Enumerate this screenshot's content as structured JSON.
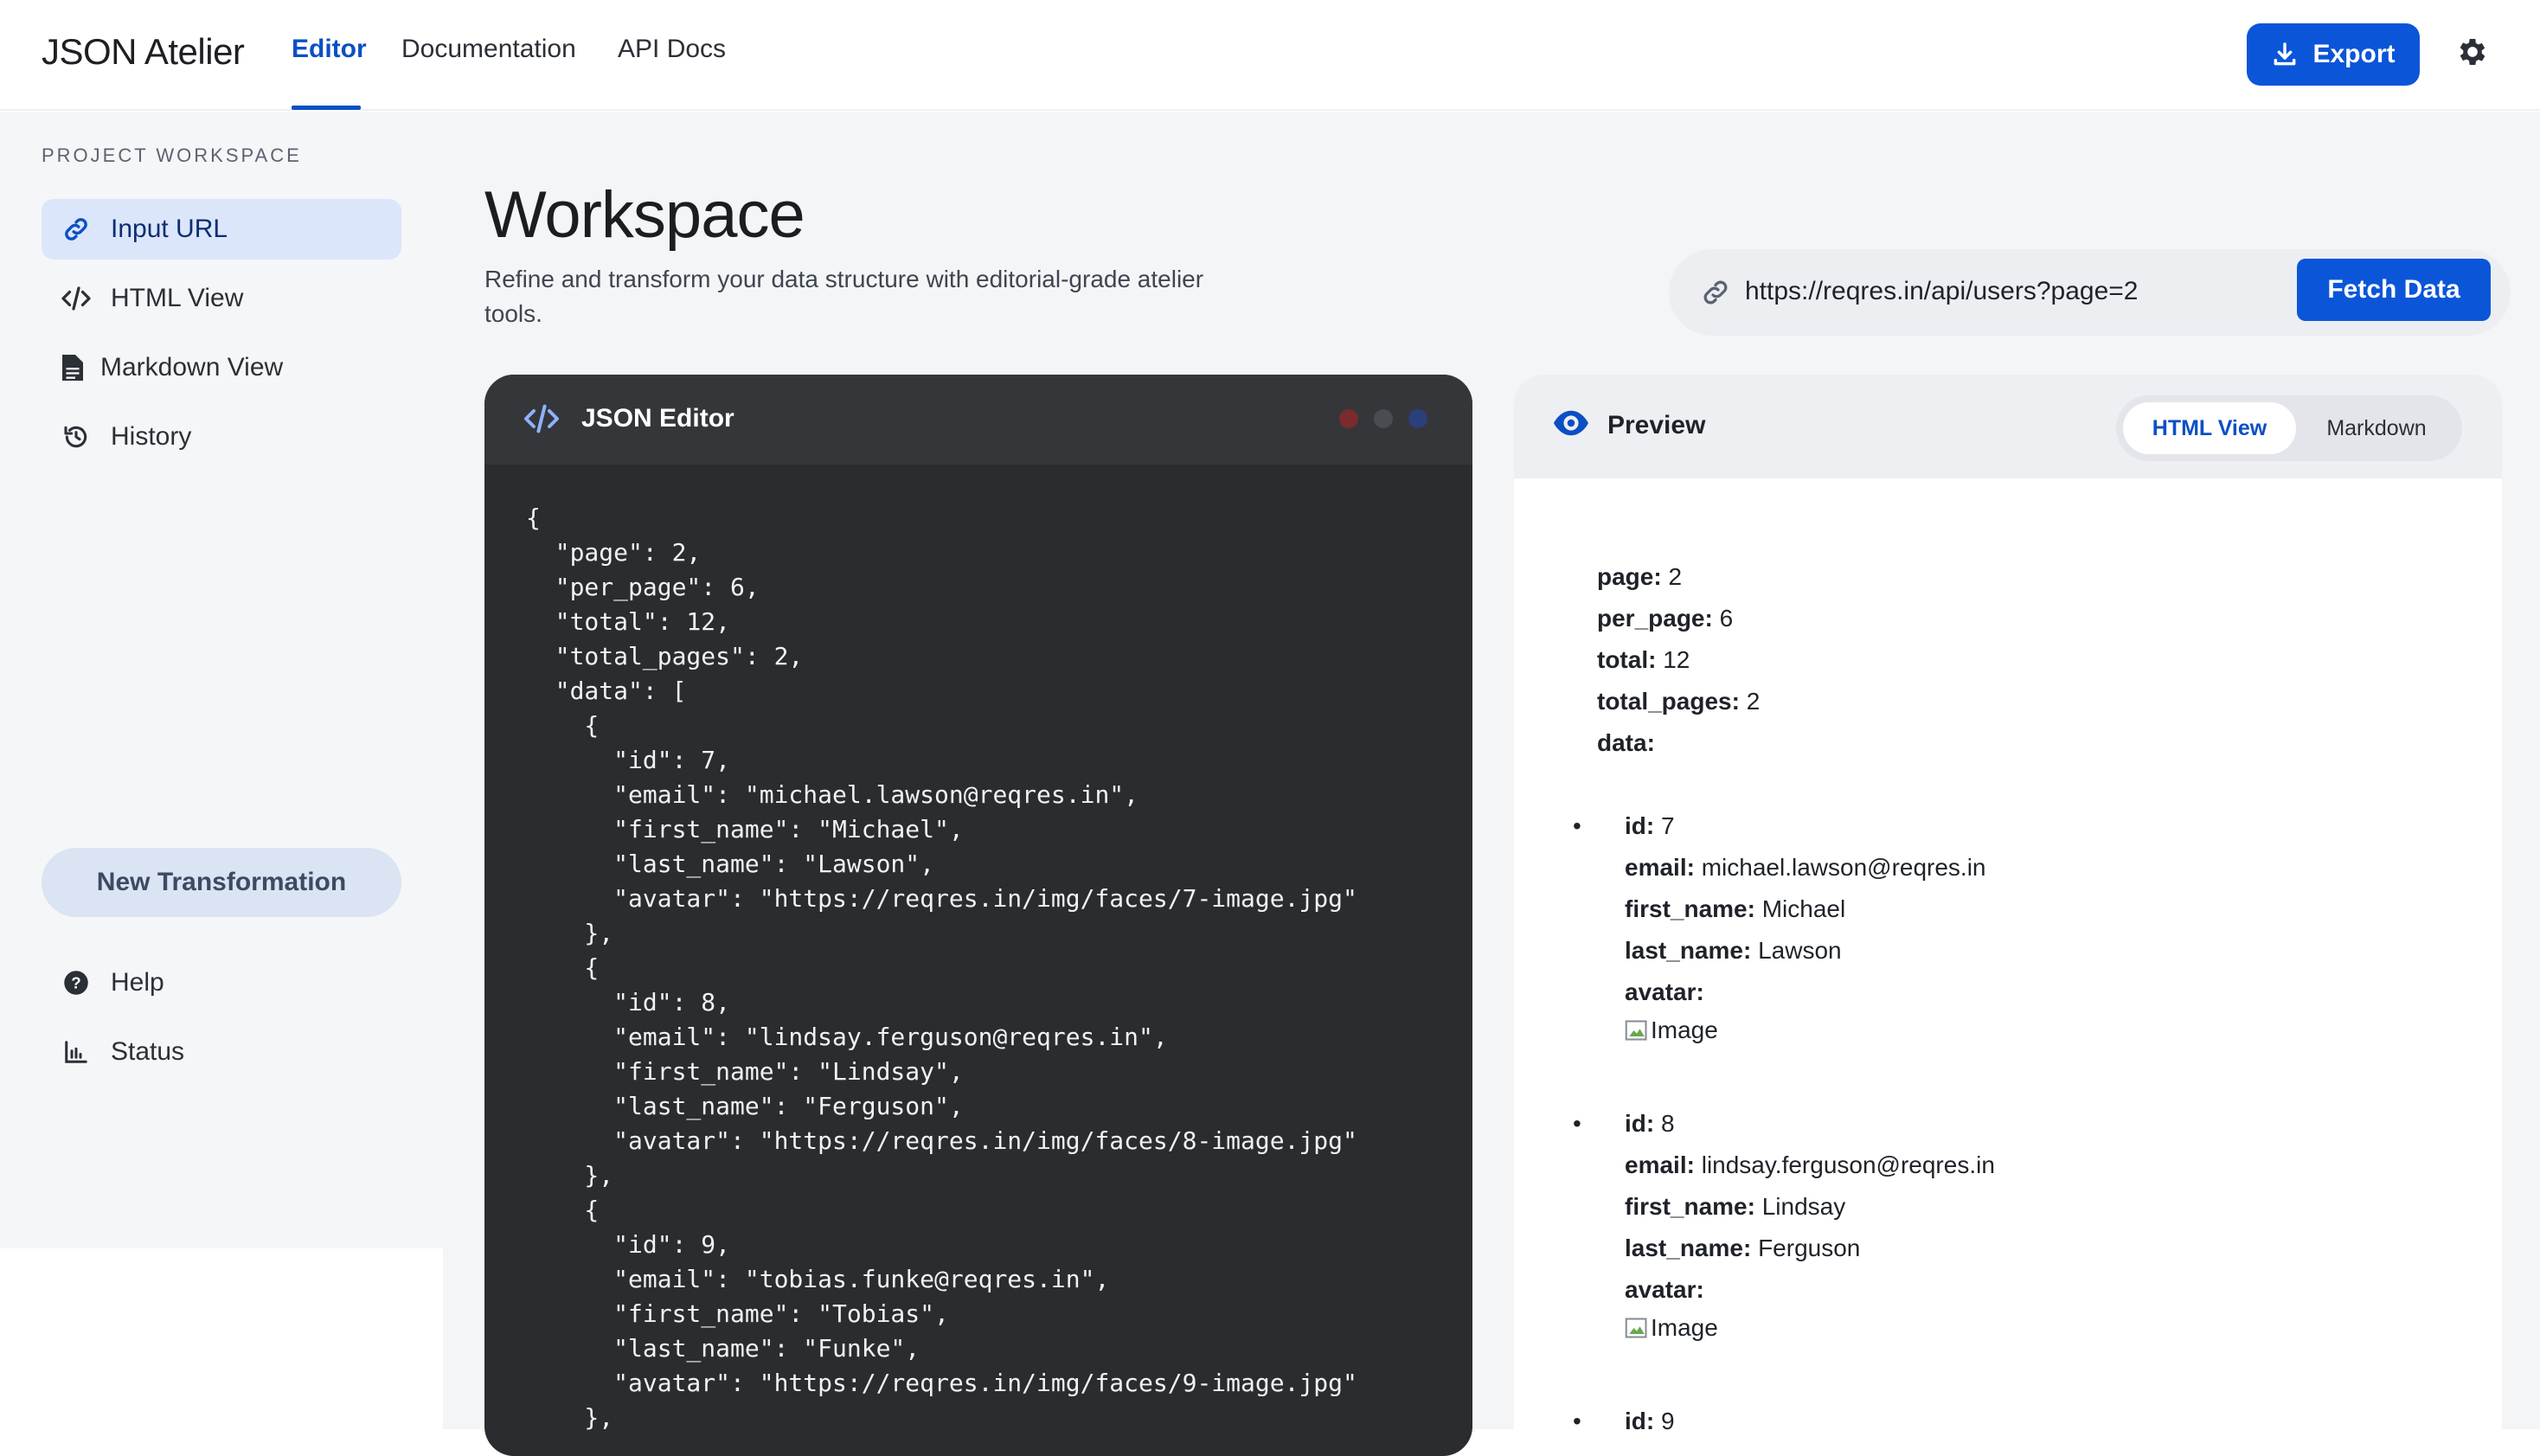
{
  "app": {
    "brand": "JSON Atelier",
    "nav": [
      "Editor",
      "Documentation",
      "API Docs"
    ],
    "export_label": "Export"
  },
  "sidebar": {
    "title": "PROJECT WORKSPACE",
    "items": [
      {
        "label": "Input URL",
        "icon": "link-icon"
      },
      {
        "label": "HTML View",
        "icon": "code-icon"
      },
      {
        "label": "Markdown View",
        "icon": "document-icon"
      },
      {
        "label": "History",
        "icon": "history-icon"
      }
    ],
    "new_label": "New Transformation",
    "footer": [
      {
        "label": "Help",
        "icon": "help-icon"
      },
      {
        "label": "Status",
        "icon": "chart-icon"
      }
    ]
  },
  "main": {
    "title": "Workspace",
    "subtitle": "Refine and transform your data structure with editorial-grade atelier tools.",
    "url_value": "https://reqres.in/api/users?page=2",
    "fetch_label": "Fetch Data"
  },
  "editor": {
    "title": "JSON Editor",
    "code": "{\n  \"page\": 2,\n  \"per_page\": 6,\n  \"total\": 12,\n  \"total_pages\": 2,\n  \"data\": [\n    {\n      \"id\": 7,\n      \"email\": \"michael.lawson@reqres.in\",\n      \"first_name\": \"Michael\",\n      \"last_name\": \"Lawson\",\n      \"avatar\": \"https://reqres.in/img/faces/7-image.jpg\"\n    },\n    {\n      \"id\": 8,\n      \"email\": \"lindsay.ferguson@reqres.in\",\n      \"first_name\": \"Lindsay\",\n      \"last_name\": \"Ferguson\",\n      \"avatar\": \"https://reqres.in/img/faces/8-image.jpg\"\n    },\n    {\n      \"id\": 9,\n      \"email\": \"tobias.funke@reqres.in\",\n      \"first_name\": \"Tobias\",\n      \"last_name\": \"Funke\",\n      \"avatar\": \"https://reqres.in/img/faces/9-image.jpg\"\n    },"
  },
  "preview": {
    "title": "Preview",
    "tabs": [
      "HTML View",
      "Markdown"
    ],
    "top": [
      {
        "k": "page:",
        "v": "2"
      },
      {
        "k": "per_page:",
        "v": "6"
      },
      {
        "k": "total:",
        "v": "12"
      },
      {
        "k": "total_pages:",
        "v": "2"
      },
      {
        "k": "data:",
        "v": ""
      }
    ],
    "records": [
      {
        "bullet": "•",
        "id_k": "id:",
        "id_v": "7",
        "email_k": "email:",
        "email_v": "michael.lawson@reqres.in",
        "first_k": "first_name:",
        "first_v": "Michael",
        "last_k": "last_name:",
        "last_v": "Lawson",
        "avatar_k": "avatar:",
        "img_alt": "Image"
      },
      {
        "bullet": "•",
        "id_k": "id:",
        "id_v": "8",
        "email_k": "email:",
        "email_v": "lindsay.ferguson@reqres.in",
        "first_k": "first_name:",
        "first_v": "Lindsay",
        "last_k": "last_name:",
        "last_v": "Ferguson",
        "avatar_k": "avatar:",
        "img_alt": "Image"
      },
      {
        "bullet": "•",
        "id_k": "id:",
        "id_v": "9"
      }
    ]
  },
  "colors": {
    "accent": "#0b55d9",
    "editor_bg": "#2b2c2f",
    "dot_red": "#7a2b2e",
    "dot_gray": "#4a4c52",
    "dot_blue": "#2b3f7a"
  }
}
